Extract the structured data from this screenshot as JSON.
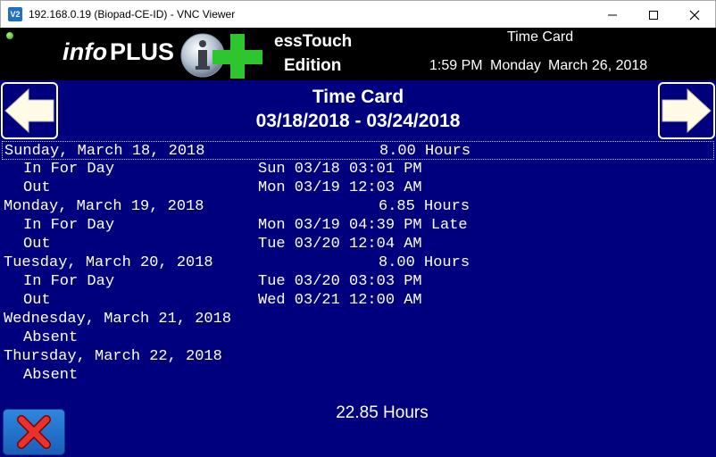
{
  "window": {
    "title": "192.168.0.19 (Biopad-CE-ID) - VNC Viewer",
    "app_icon_text": "V2",
    "controls": [
      "minimize-icon",
      "maximize-icon",
      "close-icon"
    ]
  },
  "header": {
    "brand_info": "info",
    "brand_plus": "PLUS",
    "brand_touch": "essTouch",
    "brand_edition": "Edition",
    "title": "Time Card",
    "time": "1:59 PM",
    "day": "Monday",
    "date": "March 26, 2018"
  },
  "timecard": {
    "title": "Time Card",
    "range": "03/18/2018 - 03/24/2018",
    "prev_icon": "arrow-left-icon",
    "next_icon": "arrow-right-icon",
    "rows": [
      {
        "c1": "Sunday, March 18, 2018",
        "c2": "",
        "c3": "8.00 Hours",
        "indent": false
      },
      {
        "c1": "In For Day",
        "c2": "Sun 03/18 03:01 PM",
        "c3": "",
        "indent": true
      },
      {
        "c1": "Out",
        "c2": "Mon 03/19 12:03 AM",
        "c3": "",
        "indent": true
      },
      {
        "c1": "Monday, March 19, 2018",
        "c2": "",
        "c3": "6.85 Hours",
        "indent": false
      },
      {
        "c1": "In For Day",
        "c2": "Mon 03/19 04:39 PM Late",
        "c3": "",
        "indent": true
      },
      {
        "c1": "Out",
        "c2": "Tue 03/20 12:04 AM",
        "c3": "",
        "indent": true
      },
      {
        "c1": "Tuesday, March 20, 2018",
        "c2": "",
        "c3": "8.00 Hours",
        "indent": false
      },
      {
        "c1": "In For Day",
        "c2": "Tue 03/20 03:03 PM",
        "c3": "",
        "indent": true
      },
      {
        "c1": "Out",
        "c2": "Wed 03/21 12:00 AM",
        "c3": "",
        "indent": true
      },
      {
        "c1": "Wednesday, March 21, 2018",
        "c2": "",
        "c3": "",
        "indent": false
      },
      {
        "c1": "Absent",
        "c2": "",
        "c3": "",
        "indent": true
      },
      {
        "c1": "Thursday, March 22, 2018",
        "c2": "",
        "c3": "",
        "indent": false
      },
      {
        "c1": "Absent",
        "c2": "",
        "c3": "",
        "indent": true
      }
    ],
    "total": "22.85 Hours",
    "close_icon": "red-x-close-icon"
  },
  "colors": {
    "panel_blue": "#00007f",
    "header_black": "#000000",
    "arrow_fill": "#fffbe6",
    "logo_green": "#2ec52e"
  }
}
